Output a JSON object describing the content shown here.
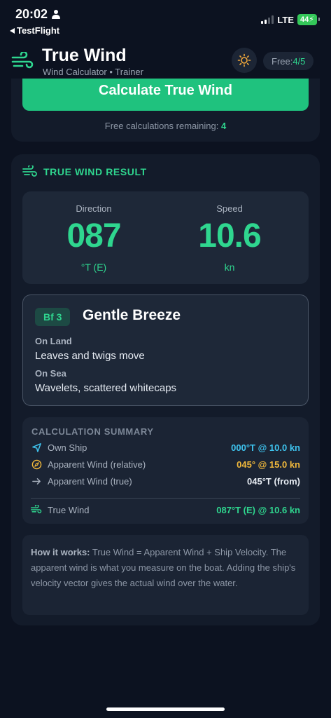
{
  "status_bar": {
    "time": "20:02",
    "back_app": "TestFlight",
    "network": "LTE",
    "battery": "44"
  },
  "header": {
    "title": "True Wind",
    "subtitle": "Wind Calculator • Trainer",
    "free_label": "Free: ",
    "free_count": "4/5"
  },
  "calculator": {
    "button_label": "Calculate True Wind",
    "remaining_label": "Free calculations remaining: ",
    "remaining_count": "4"
  },
  "result": {
    "title": "TRUE WIND RESULT",
    "direction_label": "Direction",
    "direction_value": "087",
    "direction_unit": "°T (E)",
    "speed_label": "Speed",
    "speed_value": "10.6",
    "speed_unit": "kn"
  },
  "beaufort": {
    "badge": "Bf 3",
    "name": "Gentle Breeze",
    "land_label": "On Land",
    "land_text": "Leaves and twigs move",
    "sea_label": "On Sea",
    "sea_text": "Wavelets, scattered whitecaps"
  },
  "summary": {
    "title": "CALCULATION SUMMARY",
    "rows": [
      {
        "label": "Own Ship",
        "value": "000°T @ 10.0 kn",
        "color": "#3ec3ee",
        "icon": "navigation-icon"
      },
      {
        "label": "Apparent Wind (relative)",
        "value": "045° @ 15.0 kn",
        "color": "#f2b93b",
        "icon": "compass-icon"
      },
      {
        "label": "Apparent Wind (true)",
        "value": "045°T (from)",
        "color": "#e6ebf2",
        "icon": "arrow-right-icon"
      }
    ],
    "true_wind": {
      "label": "True Wind",
      "value": "087°T (E) @ 10.6 kn",
      "color": "#2fd68f",
      "icon": "wind-icon"
    }
  },
  "how_it_works": {
    "heading": "How it works:",
    "text": " True Wind = Apparent Wind + Ship Velocity. The apparent wind is what you measure on the boat. Adding the ship's velocity vector gives the actual wind over the water."
  },
  "colors": {
    "accent": "#2fd68f",
    "background": "#0c1220",
    "card": "#131b2a"
  }
}
